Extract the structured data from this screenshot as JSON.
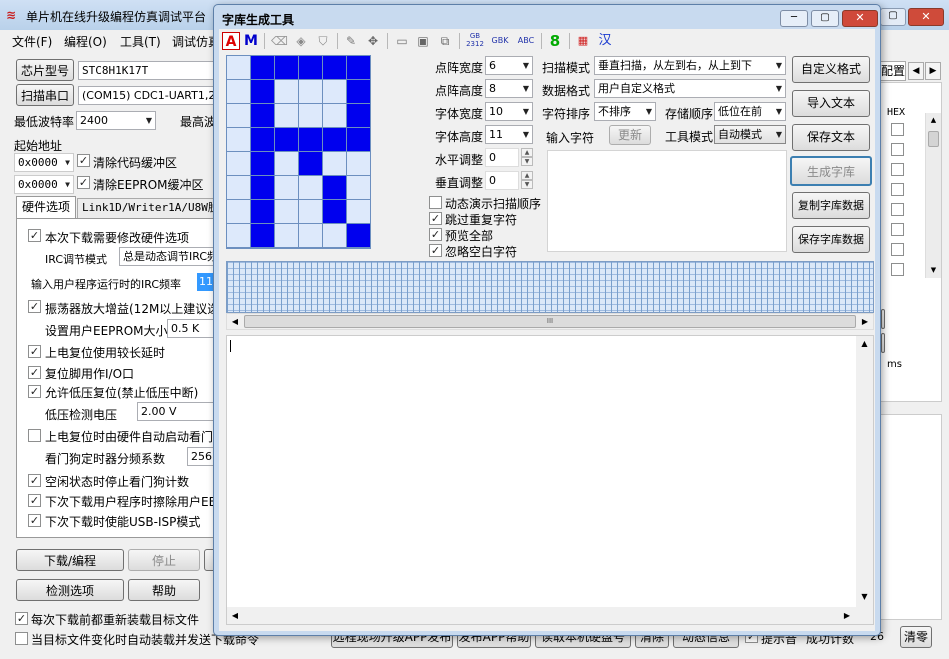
{
  "main": {
    "title": "单片机在线升级编程仿真调试平台",
    "menu": [
      "文件(F)",
      "编程(O)",
      "工具(T)",
      "调试仿真"
    ],
    "chip_type_btn": "芯片型号",
    "chip_type_value": "STC8H1K17T",
    "scan_port_btn": "扫描串口",
    "port_value": "(COM15) CDC1-UART1,2CD",
    "min_baud_label": "最低波特率",
    "min_baud_value": "2400",
    "max_baud_label": "最高波",
    "start_addr_label": "起始地址",
    "addr1": "0x0000",
    "clear_code_label": "清除代码缓冲区",
    "addr2": "0x0000",
    "clear_eeprom_label": "清除EEPROM缓冲区",
    "tabs": [
      "硬件选项",
      "Link1D/Writer1A/U8W脱机"
    ],
    "hw_options": {
      "opt1": "本次下载需要修改硬件选项",
      "irc_mode_label": "IRC调节模式",
      "irc_mode_value": "总是动态调节IRC频",
      "irc_freq_label": "输入用户程序运行时的IRC频率",
      "irc_freq_value": "11.",
      "opt_amp": "振荡器放大增益(12M以上建议选",
      "eeprom_label": "设置用户EEPROM大小",
      "eeprom_value": "0.5 K",
      "opt_delay": "上电复位使用较长延时",
      "opt_reset_io": "复位脚用作I/O口",
      "opt_lvr": "允许低压复位(禁止低压中断)",
      "lv_label": "低压检测电压",
      "lv_value": "2.00 V",
      "opt_wdt": "上电复位时由硬件自动启动看门",
      "wdt_div_label": "看门狗定时器分频系数",
      "wdt_div_value": "256",
      "opt_idle": "空闲状态时停止看门狗计数",
      "opt_erase": "下次下载用户程序时擦除用户EE",
      "opt_usb": "下次下载时使能USB-ISP模式"
    },
    "download_btn": "下载/编程",
    "stop_btn": "停止",
    "check_btn": "检测选项",
    "help_btn": "帮助",
    "reload_label": "每次下载前都重新装载目标文件",
    "auto_send_label": "当目标文件变化时自动装载并发送下载命令",
    "bottom_buttons": [
      "远程现场升级APP发布",
      "发布APP帮助",
      "读取本机硬盘号",
      "清除",
      "动态信息"
    ],
    "prompt_label": "提示音",
    "success_label": "成功计数",
    "success_count": "26",
    "clear_btn": "清零",
    "right_tab": "配置",
    "hex_label": "HEX",
    "ms_label": "ms"
  },
  "dialog": {
    "title": "字库生成工具",
    "toolbar_icons": [
      "font-a-icon",
      "font-m-icon",
      "eraser-icon",
      "fill-icon",
      "stamp-icon",
      "pencil-icon",
      "move-icon",
      "open-icon",
      "save-icon",
      "saveas-icon",
      "gb2312-icon",
      "gbk-icon",
      "abc-icon",
      "digit8-icon",
      "palette-icon",
      "han-icon"
    ],
    "toolbar_text": {
      "gb_top": "GB",
      "gb_bottom": "2312",
      "gbk": "GBK",
      "abc": "ABC",
      "digit": "8",
      "han": "汉",
      "a": "A",
      "m": "M"
    },
    "pixel_grid": [
      [
        0,
        1,
        1,
        1,
        1,
        1
      ],
      [
        0,
        1,
        0,
        0,
        0,
        1
      ],
      [
        0,
        1,
        0,
        0,
        0,
        1
      ],
      [
        0,
        1,
        1,
        1,
        1,
        1
      ],
      [
        0,
        1,
        0,
        1,
        0,
        0
      ],
      [
        0,
        1,
        0,
        0,
        1,
        0
      ],
      [
        0,
        1,
        0,
        0,
        1,
        0
      ],
      [
        0,
        1,
        0,
        0,
        0,
        1
      ]
    ],
    "colors": {
      "on": "#0000ee",
      "off": "#dde9fb",
      "grid": "#6c8fbf"
    },
    "fields": {
      "dot_width_label": "点阵宽度",
      "dot_width_value": "6",
      "dot_height_label": "点阵高度",
      "dot_height_value": "8",
      "font_width_label": "字体宽度",
      "font_width_value": "10",
      "font_height_label": "字体高度",
      "font_height_value": "11",
      "h_adjust_label": "水平调整",
      "h_adjust_value": "0",
      "v_adjust_label": "垂直调整",
      "v_adjust_value": "0",
      "scan_mode_label": "扫描模式",
      "scan_mode_value": "垂直扫描，从左到右，从上到下",
      "data_format_label": "数据格式",
      "data_format_value": "用户自定义格式",
      "char_sort_label": "字符排序",
      "char_sort_value": "不排序",
      "store_order_label": "存储顺序",
      "store_order_value": "低位在前",
      "input_char_label": "输入字符",
      "update_btn": "更新",
      "tool_mode_label": "工具模式",
      "tool_mode_value": "自动模式"
    },
    "checks": {
      "anim": "动态演示扫描顺序",
      "skip_dup": "跳过重复字符",
      "preview": "预览全部",
      "ignore_blank": "忽略空白字符"
    },
    "buttons": [
      "自定义格式",
      "导入文本",
      "保存文本",
      "生成字库",
      "复制字库数据",
      "保存字库数据"
    ],
    "scroll_mid": "III"
  }
}
